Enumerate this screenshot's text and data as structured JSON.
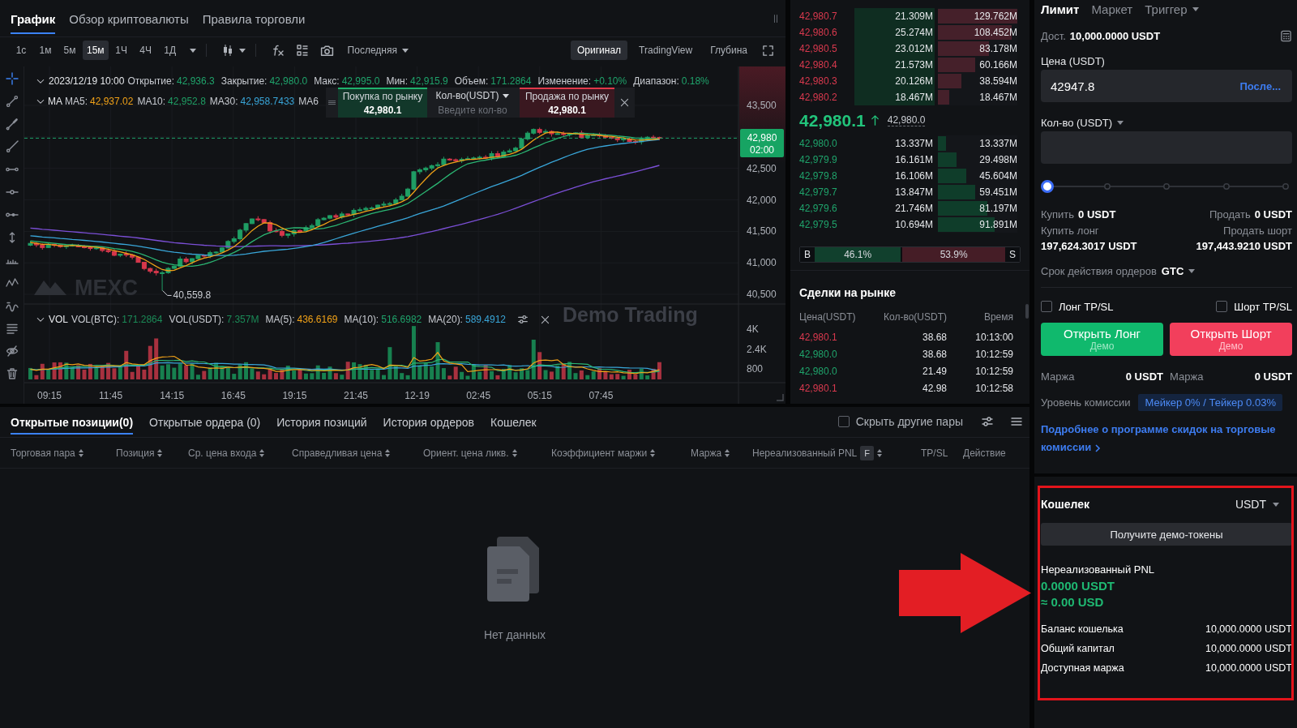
{
  "chart_panel": {
    "tabs": [
      {
        "label": "График",
        "selected": true
      },
      {
        "label": "Обзор криптовалюты",
        "selected": false
      },
      {
        "label": "Правила торговли",
        "selected": false
      }
    ],
    "intervals": [
      {
        "label": "1с",
        "selected": false
      },
      {
        "label": "1м",
        "selected": false
      },
      {
        "label": "5м",
        "selected": false
      },
      {
        "label": "15м",
        "selected": true
      },
      {
        "label": "1Ч",
        "selected": false
      },
      {
        "label": "4Ч",
        "selected": false
      },
      {
        "label": "1Д",
        "selected": false
      }
    ],
    "price_source": "Последняя",
    "views": [
      {
        "label": "Оригинал",
        "selected": true
      },
      {
        "label": "TradingView",
        "selected": false
      },
      {
        "label": "Глубина",
        "selected": false
      }
    ],
    "drawing_tools": [
      {
        "kind": "crosshair",
        "selected": true
      },
      {
        "kind": "segment",
        "selected": false
      },
      {
        "kind": "pen",
        "selected": false
      },
      {
        "kind": "ray",
        "selected": false
      },
      {
        "kind": "h-segment",
        "selected": false
      },
      {
        "kind": "h-line",
        "selected": false
      },
      {
        "kind": "h-ray",
        "selected": false
      },
      {
        "kind": "v-arrows",
        "selected": false
      },
      {
        "kind": "ruler",
        "selected": false
      },
      {
        "kind": "pattern",
        "selected": false
      },
      {
        "kind": "wave",
        "selected": false
      },
      {
        "kind": "layers",
        "selected": false
      },
      {
        "kind": "hide",
        "selected": false
      },
      {
        "kind": "trash",
        "selected": false
      }
    ],
    "ohlc": {
      "date": "2023/12/19 10:00",
      "items": [
        {
          "label": "Открытие:",
          "value": "42,936.3"
        },
        {
          "label": "Закрытие:",
          "value": "42,980.0"
        },
        {
          "label": "Макс:",
          "value": "42,995.0"
        },
        {
          "label": "Мин:",
          "value": "42,915.9"
        },
        {
          "label": "Объем:",
          "value": "171.2864"
        },
        {
          "label": "Изменение:",
          "value": "+0.10%"
        },
        {
          "label": "Диапазон:",
          "value": "0.18%"
        }
      ]
    },
    "ma": {
      "label": "MA",
      "items": [
        {
          "label": "MA5:",
          "value": "42,937.02",
          "color": "#f0a118"
        },
        {
          "label": "MA10:",
          "value": "42,952.8",
          "color": "#1f9e64"
        },
        {
          "label": "MA30:",
          "value": "42,958.7433",
          "color": "#39a6d9"
        },
        {
          "label": "MA6"
        }
      ]
    },
    "quick_trade": {
      "buy": {
        "label": "Покупка по рынку",
        "price": "42,980.1"
      },
      "amount": {
        "label": "Кол-во(USDT)",
        "placeholder": "Введите кол-во"
      },
      "sell": {
        "label": "Продажа по рынку",
        "price": "42,980.1"
      }
    },
    "price_axis": [
      "43,500",
      "42,500",
      "42,000",
      "41,500",
      "41,000",
      "40,500"
    ],
    "last_price": {
      "price": "42,980",
      "countdown": "02:00"
    },
    "low_price": "40,559.8",
    "watermarks": [
      "MEXC",
      "Demo Trading"
    ],
    "volume": {
      "label": "VOL",
      "items": [
        {
          "label": "VOL(BTC):",
          "value": "171.2864",
          "color": "#1b8a57"
        },
        {
          "label": "VOL(USDT):",
          "value": "7.357M",
          "color": "#1b8a57"
        },
        {
          "label": "MA(5):",
          "value": "436.6169",
          "color": "#f0a118"
        },
        {
          "label": "MA(10):",
          "value": "516.6982",
          "color": "#1fa36b"
        },
        {
          "label": "MA(20):",
          "value": "589.4912",
          "color": "#39a6d9"
        }
      ],
      "axis": [
        "4K",
        "2.4K",
        "800"
      ]
    },
    "time_axis": [
      "09:15",
      "11:45",
      "14:15",
      "16:45",
      "19:15",
      "21:45",
      "12-19",
      "02:45",
      "05:15",
      "07:45"
    ]
  },
  "order_book": {
    "asks": [
      {
        "price": "42,980.7",
        "amount": "21.309M",
        "total": "129.762M",
        "level": 1,
        "highlighted": true
      },
      {
        "price": "42,980.6",
        "amount": "25.274M",
        "total": "108.452M",
        "level": 0.93,
        "highlighted": true
      },
      {
        "price": "42,980.5",
        "amount": "23.012M",
        "total": "83.178M",
        "level": 0.64,
        "highlighted": true
      },
      {
        "price": "42,980.4",
        "amount": "21.573M",
        "total": "60.166M",
        "level": 0.47,
        "highlighted": true
      },
      {
        "price": "42,980.3",
        "amount": "20.126M",
        "total": "38.594M",
        "level": 0.3,
        "highlighted": true
      },
      {
        "price": "42,980.2",
        "amount": "18.467M",
        "total": "18.467M",
        "level": 0.14,
        "highlighted": true
      }
    ],
    "last_price": "42,980.1",
    "mark_price": "42,980.0",
    "bids": [
      {
        "price": "42,980.0",
        "amount": "13.337M",
        "total": "13.337M",
        "level": 0.1,
        "highlighted": false
      },
      {
        "price": "42,979.9",
        "amount": "16.161M",
        "total": "29.498M",
        "level": 0.23,
        "highlighted": false
      },
      {
        "price": "42,979.8",
        "amount": "16.106M",
        "total": "45.604M",
        "level": 0.36,
        "highlighted": false
      },
      {
        "price": "42,979.7",
        "amount": "13.847M",
        "total": "59.451M",
        "level": 0.47,
        "highlighted": false
      },
      {
        "price": "42,979.6",
        "amount": "21.746M",
        "total": "81.197M",
        "level": 0.62,
        "highlighted": false
      },
      {
        "price": "42,979.5",
        "amount": "10.694M",
        "total": "91.891M",
        "level": 0.71,
        "highlighted": false
      }
    ],
    "ratio": {
      "buy_label": "B",
      "buy": "46.1%",
      "sell": "53.9%",
      "sell_label": "S",
      "level": 0.461
    }
  },
  "market_trades": {
    "title": "Сделки на рынке",
    "columns": [
      "Цена(USDT)",
      "Кол-во(USDT)",
      "Время"
    ],
    "rows": [
      {
        "kind": "sell",
        "price": "42,980.1",
        "amount": "38.68",
        "time": "10:13:00"
      },
      {
        "kind": "buy",
        "price": "42,980.0",
        "amount": "38.68",
        "time": "10:12:59"
      },
      {
        "kind": "buy",
        "price": "42,980.0",
        "amount": "21.49",
        "time": "10:12:59"
      },
      {
        "kind": "sell",
        "price": "42,980.1",
        "amount": "42.98",
        "time": "10:12:58"
      }
    ]
  },
  "order_form": {
    "tabs": [
      {
        "label": "Лимит",
        "selected": true,
        "menu": false
      },
      {
        "label": "Маркет",
        "selected": false,
        "menu": false
      },
      {
        "label": "Триггер",
        "selected": false,
        "menu": true
      }
    ],
    "available": {
      "label": "Дост.",
      "value": "10,000.0000 USDT"
    },
    "price": {
      "label": "Цена (USDT)",
      "value": "42947.8",
      "action": "После..."
    },
    "amount": {
      "label": "Кол-во (USDT)"
    },
    "slider": {
      "level": 0
    },
    "buy_sell": [
      {
        "label": "Купить",
        "value": "0 USDT"
      },
      {
        "label": "Продать",
        "value": "0 USDT"
      }
    ],
    "max_open": [
      {
        "label": "Купить лонг",
        "value": "197,624.3017 USDT"
      },
      {
        "label": "Продать шорт",
        "value": "197,443.9210 USDT"
      }
    ],
    "time_in_force": {
      "label": "Срок действия ордеров",
      "value": "GTC"
    },
    "tp_sl": [
      {
        "label": "Лонг TP/SL",
        "checked": false
      },
      {
        "label": "Шорт TP/SL",
        "checked": false
      }
    ],
    "actions": [
      {
        "kind": "long",
        "label": "Открыть Лонг",
        "note": "Демо"
      },
      {
        "kind": "short",
        "label": "Открыть Шорт",
        "note": "Демо"
      }
    ],
    "margins": [
      {
        "label": "Маржа",
        "value": "0 USDT"
      },
      {
        "label": "Маржа",
        "value": "0 USDT"
      }
    ],
    "fee": {
      "label": "Уровень комиссии",
      "value": "Мейкер 0% / Тейкер 0.03%"
    },
    "link": "Подробнее о программе скидок на торговые комиссии"
  },
  "positions": {
    "tabs": [
      {
        "label": "Открытые позиции(0)",
        "selected": true
      },
      {
        "label": "Открытые ордера (0)",
        "selected": false
      },
      {
        "label": "История позиций",
        "selected": false
      },
      {
        "label": "История ордеров",
        "selected": false
      },
      {
        "label": "Кошелек",
        "selected": false
      }
    ],
    "hide_other_pairs": {
      "label": "Скрыть другие пары",
      "checked": false
    },
    "columns": [
      {
        "label": "Торговая пара",
        "sortable": true
      },
      {
        "label": "Позиция",
        "sortable": true
      },
      {
        "label": "Ср. цена входа",
        "sortable": true
      },
      {
        "label": "Справедливая цена",
        "sortable": true
      },
      {
        "label": "Ориент. цена ликв.",
        "sortable": true
      },
      {
        "label": "Коэффициент маржи",
        "sortable": true
      },
      {
        "label": "Маржа",
        "sortable": true
      },
      {
        "label": "Нереализованный PNL",
        "badge": "F",
        "sortable": true
      },
      {
        "label": "TP/SL",
        "sortable": false
      },
      {
        "label": "Действие",
        "sortable": false
      }
    ],
    "empty_text": "Нет данных"
  },
  "wallet": {
    "highlighted": true,
    "title": "Кошелек",
    "currency": "USDT",
    "button": "Получите демо-токены",
    "pnl_label": "Нереализованный PNL",
    "pnl": "0.0000 USDT",
    "pnl_usd": "≈ 0.00 USD",
    "rows": [
      {
        "label": "Баланс кошелька",
        "value": "10,000.0000 USDT"
      },
      {
        "label": "Общий капитал",
        "value": "10,000.0000 USDT"
      },
      {
        "label": "Доступная маржа",
        "value": "10,000.0000 USDT"
      }
    ]
  }
}
